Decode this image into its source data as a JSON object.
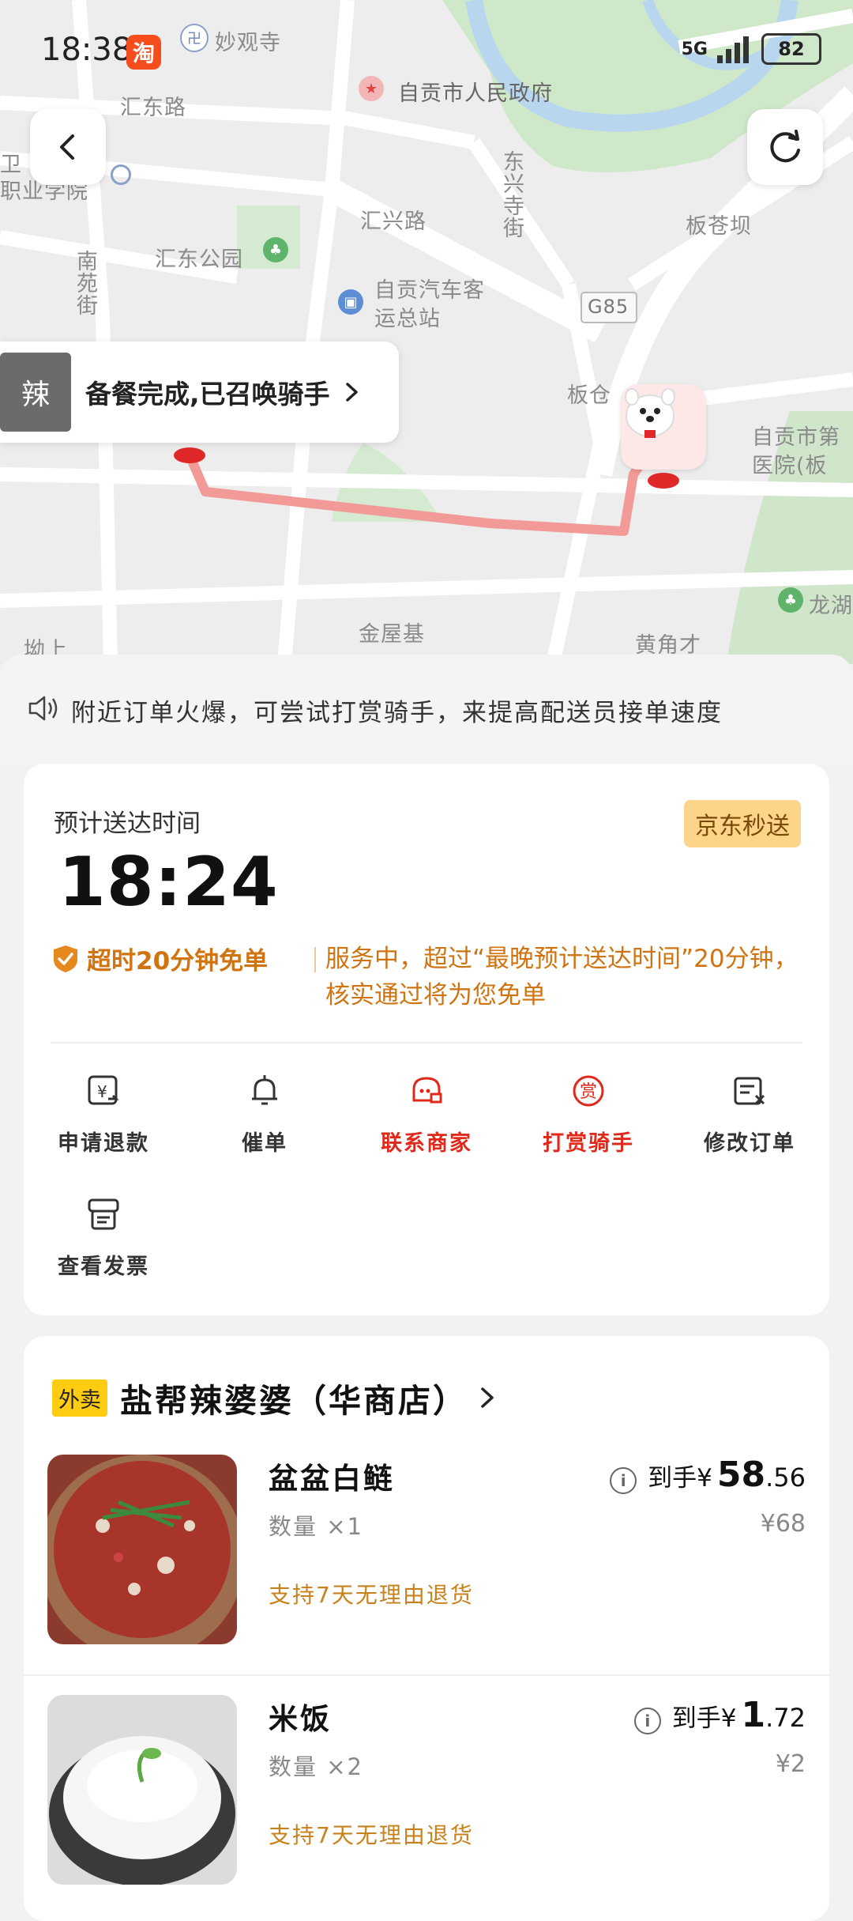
{
  "status_bar": {
    "time": "18:38",
    "app_badge": "淘",
    "network": "5G",
    "battery": "82"
  },
  "map": {
    "labels": {
      "miaoguan": "妙观寺",
      "gov": "自贡市人民政府",
      "huidong_rd": "汇东路",
      "weicheng": "卫",
      "college": "职业学院",
      "dongxing_st": "东兴寺街",
      "huixing_rd": "汇兴路",
      "bancang_ba": "板苍坝",
      "huidong_park": "汇东公园",
      "nanyuan_st": "南苑街",
      "bus_station": "自贡汽车客运总站",
      "g85": "G85",
      "bancang": "板仓",
      "hospital": "自贡市第医院(板",
      "longhu": "龙湖",
      "aoshang": "坳上",
      "jinwuji": "金屋基",
      "huangjiaocai": "黄角才"
    },
    "merchant_status": "备餐完成,已召唤骑手",
    "merchant_logo_text": "辣"
  },
  "notice": "附近订单火爆，可尝试打赏骑手，来提高配送员接单速度",
  "eta": {
    "label": "预计送达时间",
    "time": "18:24",
    "badge": "京东秒送",
    "guarantee_tag": "超时20分钟免单",
    "guarantee_desc": "服务中，超过“最晚预计送达时间”20分钟，核实通过将为您免单"
  },
  "actions": [
    {
      "label": "申请退款",
      "icon": "refund-icon"
    },
    {
      "label": "催单",
      "icon": "bell-icon"
    },
    {
      "label": "联系商家",
      "icon": "store-contact-icon"
    },
    {
      "label": "打赏骑手",
      "icon": "reward-icon"
    },
    {
      "label": "修改订单",
      "icon": "edit-order-icon"
    },
    {
      "label": "查看发票",
      "icon": "invoice-icon"
    }
  ],
  "store": {
    "tag": "外卖",
    "name": "盐帮辣婆婆（华商店）",
    "items": [
      {
        "name": "盆盆白鲢",
        "qty": "数量 ×1",
        "refund": "支持7天无理由退货",
        "price_prefix": "到手¥",
        "price_int": "58",
        "price_dec": ".56",
        "orig": "¥68"
      },
      {
        "name": "米饭",
        "qty": "数量 ×2",
        "refund": "支持7天无理由退货",
        "price_prefix": "到手¥",
        "price_int": "1",
        "price_dec": ".72",
        "orig": "¥2"
      }
    ]
  },
  "colors": {
    "accent_red": "#e0291b",
    "orange": "#d07412",
    "route": "#f19a98"
  }
}
